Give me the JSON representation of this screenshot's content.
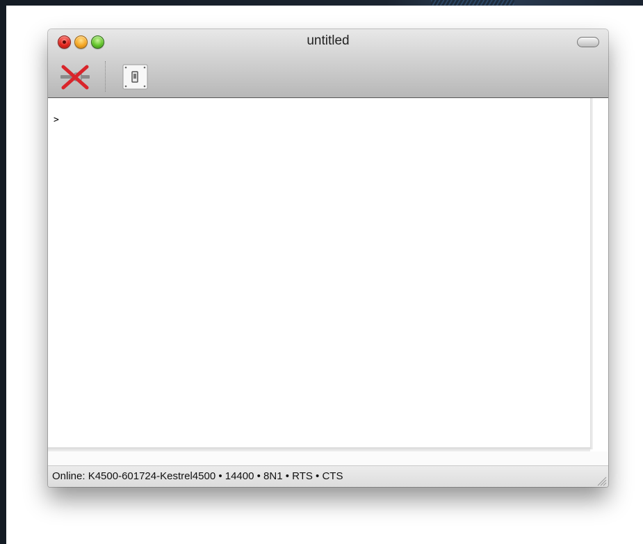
{
  "window": {
    "title": "untitled"
  },
  "toolbar": {
    "items": [
      {
        "icon": "disconnect-icon"
      },
      {
        "icon": "toggle-switch-icon"
      }
    ]
  },
  "terminal": {
    "prompt": ">"
  },
  "status_bar": {
    "text": "Online: K4500-601724-Kestrel4500 • 14400 • 8N1 • RTS • CTS"
  },
  "colors": {
    "close": "#e0231b",
    "minimize": "#f5a623",
    "zoom": "#62c42a",
    "disconnect_x": "#d9252b"
  }
}
